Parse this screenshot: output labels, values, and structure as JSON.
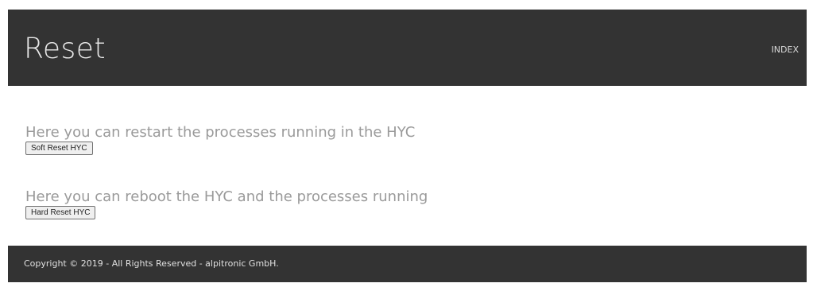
{
  "header": {
    "title": "Reset",
    "nav_link": "INDEX"
  },
  "sections": [
    {
      "description": "Here you can restart the processes running in the HYC",
      "button_label": "Soft Reset HYC"
    },
    {
      "description": "Here you can reboot the HYC and the processes running",
      "button_label": "Hard Reset HYC"
    }
  ],
  "footer": {
    "copyright": "Copyright © 2019 - All Rights Reserved - alpitronic GmbH."
  },
  "colors": {
    "header_bg": "#333333",
    "footer_bg": "#333333",
    "description_text": "#9a9a9a"
  }
}
